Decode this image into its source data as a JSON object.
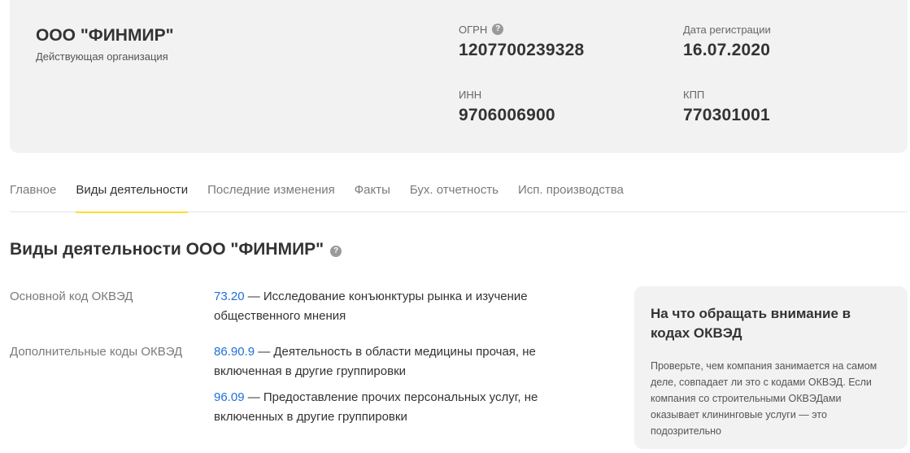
{
  "company": {
    "name": "ООО \"ФИНМИР\"",
    "status": "Действующая организация"
  },
  "fields": {
    "ogrn": {
      "label": "ОГРН",
      "value": "1207700239328"
    },
    "reg_date": {
      "label": "Дата регистрации",
      "value": "16.07.2020"
    },
    "inn": {
      "label": "ИНН",
      "value": "9706006900"
    },
    "kpp": {
      "label": "КПП",
      "value": "770301001"
    }
  },
  "help_glyph": "?",
  "tabs": [
    {
      "label": "Главное"
    },
    {
      "label": "Виды деятельности"
    },
    {
      "label": "Последние изменения"
    },
    {
      "label": "Факты"
    },
    {
      "label": "Бух. отчетность"
    },
    {
      "label": "Исп. производства"
    }
  ],
  "active_tab": "Виды деятельности",
  "section": {
    "title": "Виды деятельности ООО \"ФИНМИР\""
  },
  "okved": {
    "main_label": "Основной код ОКВЭД",
    "main": {
      "code": "73.20",
      "text": " — Исследование конъюнктуры рынка и изучение общественного мнения"
    },
    "additional_label": "Дополнительные коды ОКВЭД",
    "additional": [
      {
        "code": "86.90.9",
        "text": " — Деятельность в области медицины прочая, не включенная в другие группировки"
      },
      {
        "code": "96.09",
        "text": " — Предоставление прочих персональных услуг, не включенных в другие группировки"
      }
    ]
  },
  "tip": {
    "title": "На что обращать внимание в кодах ОКВЭД",
    "text": "Проверьте, чем компания занимается на самом деле, совпадает ли это с кодами ОКВЭД. Если компания со строительными ОКВЭДами оказывает клининговые услуги — это подозрительно"
  },
  "colors": {
    "link": "#1f6fd6",
    "tab_underline": "#ffdd2d",
    "card_background": "#f2f2f2"
  }
}
